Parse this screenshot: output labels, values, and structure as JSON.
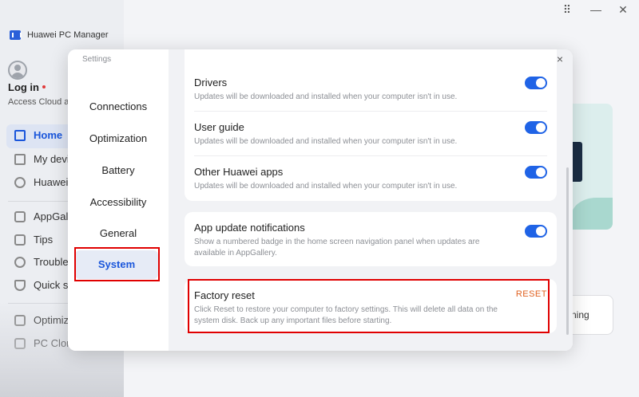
{
  "app": {
    "title": "Huawei PC Manager",
    "login_label": "Log in",
    "login_sub": "Access Cloud and"
  },
  "window_controls": {
    "grid": "⠿",
    "minimize": "—",
    "close": "✕"
  },
  "nav": {
    "items": [
      {
        "label": "Home",
        "icon": "monitor-icon"
      },
      {
        "label": "My devi",
        "icon": "devices-icon"
      },
      {
        "label": "Huawei",
        "icon": "wireless-icon"
      },
      {
        "label": "AppGall",
        "icon": "appgallery-icon"
      },
      {
        "label": "Tips",
        "icon": "tips-icon"
      },
      {
        "label": "Troubles",
        "icon": "troubleshoot-icon"
      },
      {
        "label": "Quick se",
        "icon": "shield-icon"
      },
      {
        "label": "Optimiz",
        "icon": "optimize-icon"
      },
      {
        "label": "PC Clone",
        "icon": "clone-icon"
      }
    ]
  },
  "background": {
    "button_partial": "ning"
  },
  "settings": {
    "title": "Settings",
    "close": "×",
    "nav": [
      "Connections",
      "Optimization",
      "Battery",
      "Accessibility",
      "General",
      "System"
    ],
    "selected": "System",
    "rows": [
      {
        "title": "Drivers",
        "desc": "Updates will be downloaded and installed when your computer isn't in use.",
        "enabled": true
      },
      {
        "title": "User guide",
        "desc": "Updates will be downloaded and installed when your computer isn't in use.",
        "enabled": true
      },
      {
        "title": "Other Huawei apps",
        "desc": "Updates will be downloaded and installed when your computer isn't in use.",
        "enabled": true
      }
    ],
    "notifications": {
      "title": "App update notifications",
      "desc": "Show a numbered badge in the home screen navigation panel when updates are available in AppGallery.",
      "enabled": true
    },
    "factory_reset": {
      "title": "Factory reset",
      "desc": "Click Reset to restore your computer to factory settings. This will delete all data on the system disk. Back up any important files before starting.",
      "button": "RESET"
    }
  },
  "colors": {
    "accent": "#1f63e6",
    "highlight": "#e00000",
    "reset": "#e0601f"
  }
}
